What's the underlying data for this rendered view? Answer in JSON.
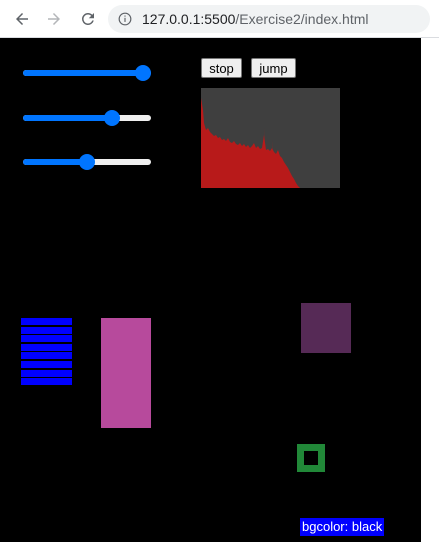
{
  "browser": {
    "url_host": "127.0.0.1:5500",
    "url_path": "/Exercise2/index.html",
    "nav": {
      "back_icon": "back-arrow-icon",
      "forward_icon": "forward-arrow-icon",
      "reload_icon": "reload-icon",
      "info_icon": "info-icon"
    }
  },
  "controls": {
    "sliders": [
      {
        "label": "",
        "level": 1.0
      },
      {
        "label": "",
        "level": 0.72
      },
      {
        "label": "",
        "level": 0.5
      }
    ],
    "stop_label": "stop",
    "jump_label": "jump"
  },
  "visualizer": {
    "background": "#3f3f3f",
    "bar_color": "#b81a1a"
  },
  "shapes": {
    "bar_count": 8,
    "bar_color": "#0000ff",
    "pink_color": "#b74a9c",
    "purple_color": "#562a56",
    "green_color": "#218838"
  },
  "status": {
    "bgcolor_text": "bgcolor: black"
  },
  "colors": {
    "page_bg": "#000000",
    "accent": "#0075ff"
  }
}
